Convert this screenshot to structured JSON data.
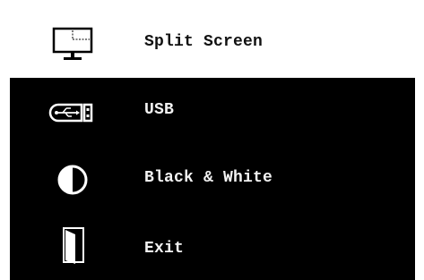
{
  "menu": {
    "selected_index": 0,
    "items": [
      {
        "label": "Split Screen",
        "icon": "monitor-split-icon",
        "selected": true
      },
      {
        "label": "USB",
        "icon": "usb-icon",
        "selected": false
      },
      {
        "label": "Black & White",
        "icon": "contrast-icon",
        "selected": false
      },
      {
        "label": "Exit",
        "icon": "door-exit-icon",
        "selected": false
      }
    ]
  },
  "colors": {
    "background": "#000000",
    "selected_background": "#ffffff",
    "selected_text": "#111111",
    "text": "#f2f2f2",
    "icon_light": "#ffffff",
    "icon_dark": "#000000"
  }
}
